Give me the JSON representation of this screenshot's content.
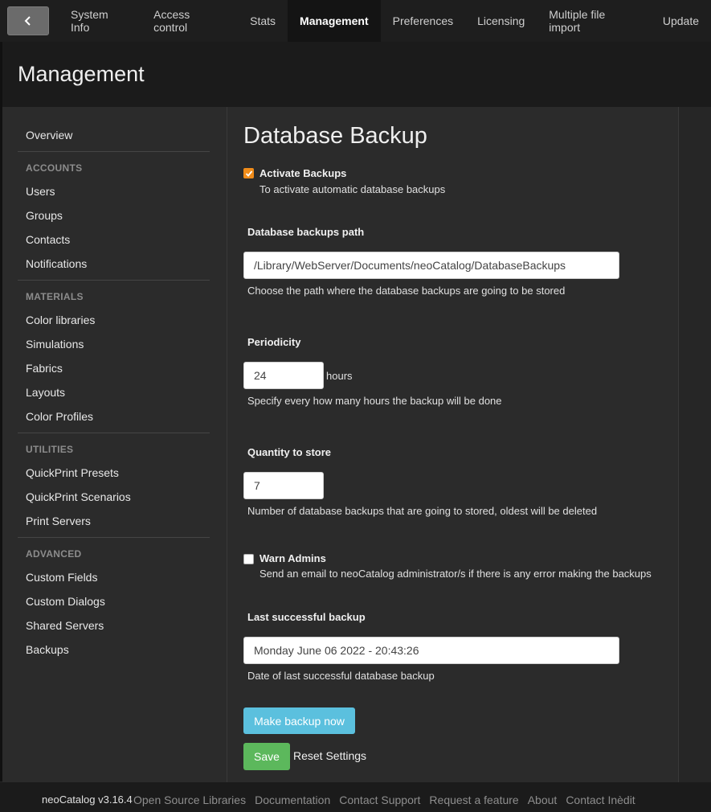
{
  "topnav": {
    "tabs": [
      "System Info",
      "Access control",
      "Stats",
      "Management",
      "Preferences",
      "Licensing",
      "Multiple file import",
      "Update"
    ],
    "active_tab": "Management"
  },
  "header": {
    "title": "Management"
  },
  "sidebar": {
    "overview": "Overview",
    "sections": [
      {
        "heading": "ACCOUNTS",
        "items": [
          "Users",
          "Groups",
          "Contacts",
          "Notifications"
        ]
      },
      {
        "heading": "MATERIALS",
        "items": [
          "Color libraries",
          "Simulations",
          "Fabrics",
          "Layouts",
          "Color Profiles"
        ]
      },
      {
        "heading": "UTILITIES",
        "items": [
          "QuickPrint Presets",
          "QuickPrint Scenarios",
          "Print Servers"
        ]
      },
      {
        "heading": "ADVANCED",
        "items": [
          "Custom Fields",
          "Custom Dialogs",
          "Shared Servers",
          "Backups"
        ]
      }
    ]
  },
  "main": {
    "title": "Database Backup",
    "activate": {
      "label": "Activate Backups",
      "help": "To activate automatic database backups",
      "checked": true
    },
    "path": {
      "label": "Database backups path",
      "value": "/Library/WebServer/Documents/neoCatalog/DatabaseBackups",
      "help": "Choose the path where the database backups are going to be stored"
    },
    "periodicity": {
      "label": "Periodicity",
      "value": "24",
      "unit": "hours",
      "help": "Specify every how many hours the backup will be done"
    },
    "quantity": {
      "label": "Quantity to store",
      "value": "7",
      "help": "Number of database backups that are going to stored, oldest will be deleted"
    },
    "warn": {
      "label": "Warn Admins",
      "help": "Send an email to neoCatalog administrator/s if there is any error making the backups",
      "checked": false
    },
    "last": {
      "label": "Last successful backup",
      "value": "Monday June 06 2022 - 20:43:26",
      "help": "Date of last successful database backup"
    },
    "buttons": {
      "backup_now": "Make backup now",
      "save": "Save",
      "reset": "Reset Settings"
    }
  },
  "footer": {
    "brand": "neoCatalog v3.16.4",
    "links": [
      "Open Source Libraries",
      "Documentation",
      "Contact Support",
      "Request a feature",
      "About",
      "Contact Inèdit"
    ]
  },
  "colors": {
    "accent_orange": "#f08c1a",
    "button_blue": "#5bc0de",
    "button_green": "#5cb85c"
  },
  "icons": {
    "back": "chevron-left-icon",
    "check": "check-icon"
  }
}
